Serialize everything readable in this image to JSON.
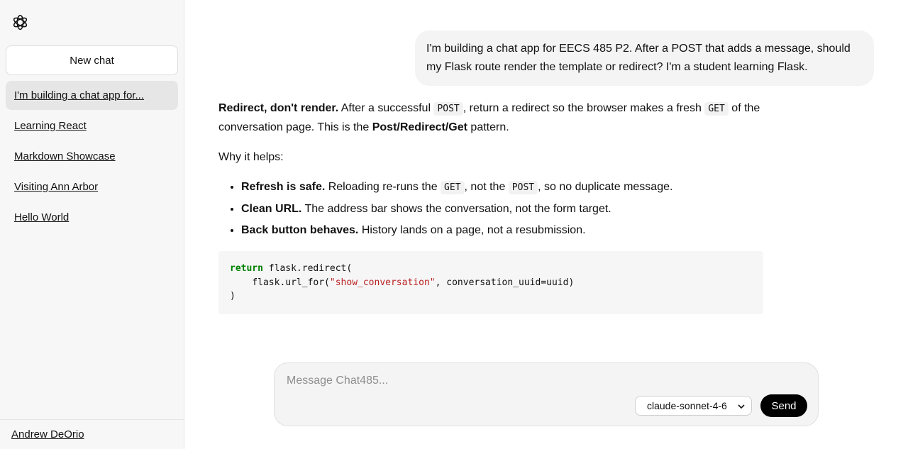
{
  "sidebar": {
    "logo_icon": "openai-logo-icon",
    "new_chat_label": "New chat",
    "conversations": [
      {
        "label": "I'm building a chat app for..."
      },
      {
        "label": "Learning React"
      },
      {
        "label": "Markdown Showcase"
      },
      {
        "label": "Visiting Ann Arbor"
      },
      {
        "label": "Hello World"
      }
    ],
    "user_name": "Andrew DeOrio"
  },
  "chat": {
    "user_message": "I'm building a chat app for EECS 485 P2. After a POST that adds a message, should my Flask route render the template or redirect? I'm a student learning Flask.",
    "assistant": {
      "p1": {
        "bold": "Redirect, don't render.",
        "t1": " After a successful ",
        "c1": "POST",
        "t2": ", return a redirect so the browser makes a fresh ",
        "c2": "GET",
        "t3": " of the conversation page. This is the ",
        "bold2": "Post/Redirect/Get",
        "t4": " pattern."
      },
      "p2": "Why it helps:",
      "bullets": [
        {
          "bold": "Refresh is safe.",
          "t1": " Reloading re-runs the ",
          "c1": "GET",
          "t2": ", not the ",
          "c2": "POST",
          "t3": ", so no duplicate message."
        },
        {
          "bold": "Clean URL.",
          "text": " The address bar shows the conversation, not the form target."
        },
        {
          "bold": "Back button behaves.",
          "text": " History lands on a page, not a resubmission."
        }
      ],
      "code": {
        "kw": "return",
        "l1": " flask.redirect(",
        "l2a": "    flask.url_for(",
        "l2str": "\"show_conversation\"",
        "l2b": ", conversation_uuid=uuid)",
        "l3": ")"
      }
    }
  },
  "composer": {
    "placeholder": "Message Chat485...",
    "model": "claude-sonnet-4-6",
    "send_label": "Send"
  }
}
